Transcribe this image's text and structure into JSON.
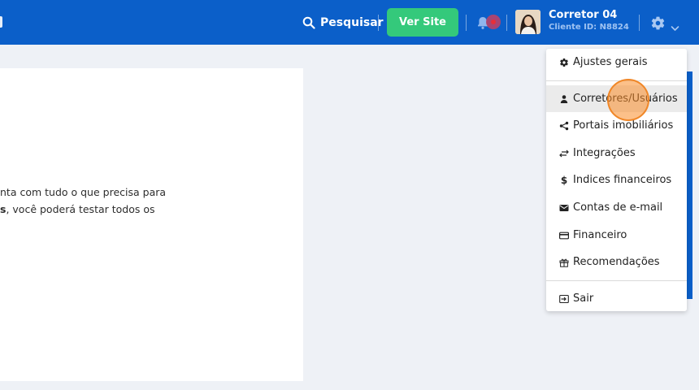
{
  "header": {
    "search_label": "Pesquisar",
    "ver_site_label": "Ver Site",
    "user": {
      "name": "Corretor 04",
      "client_id": "Cliente ID: N8824"
    }
  },
  "content": {
    "line1": "nta com tudo o que precisa para",
    "line2_bold": "s",
    "line2_rest": ", você poderá testar todos os"
  },
  "settings_menu": {
    "items": [
      {
        "label": "Ajustes gerais",
        "icon": "gear-icon"
      },
      {
        "label": "Corretores/Usuários",
        "icon": "person-icon"
      },
      {
        "label": "Portais imobiliários",
        "icon": "share-icon"
      },
      {
        "label": "Integrações",
        "icon": "swap-arrows-icon"
      },
      {
        "label": "Indices financeiros",
        "icon": "dollar-icon"
      },
      {
        "label": "Contas de e-mail",
        "icon": "envelope-icon"
      },
      {
        "label": "Financeiro",
        "icon": "credit-card-icon"
      },
      {
        "label": "Recomendações",
        "icon": "gift-icon"
      },
      {
        "label": "Sair",
        "icon": "logout-icon"
      }
    ],
    "active_index": 1
  },
  "colors": {
    "header_bg": "#0b5fc9",
    "ver_site_bg": "#34c97b",
    "page_bg": "#eef1f6",
    "menu_active_bg": "#ebebeb"
  }
}
